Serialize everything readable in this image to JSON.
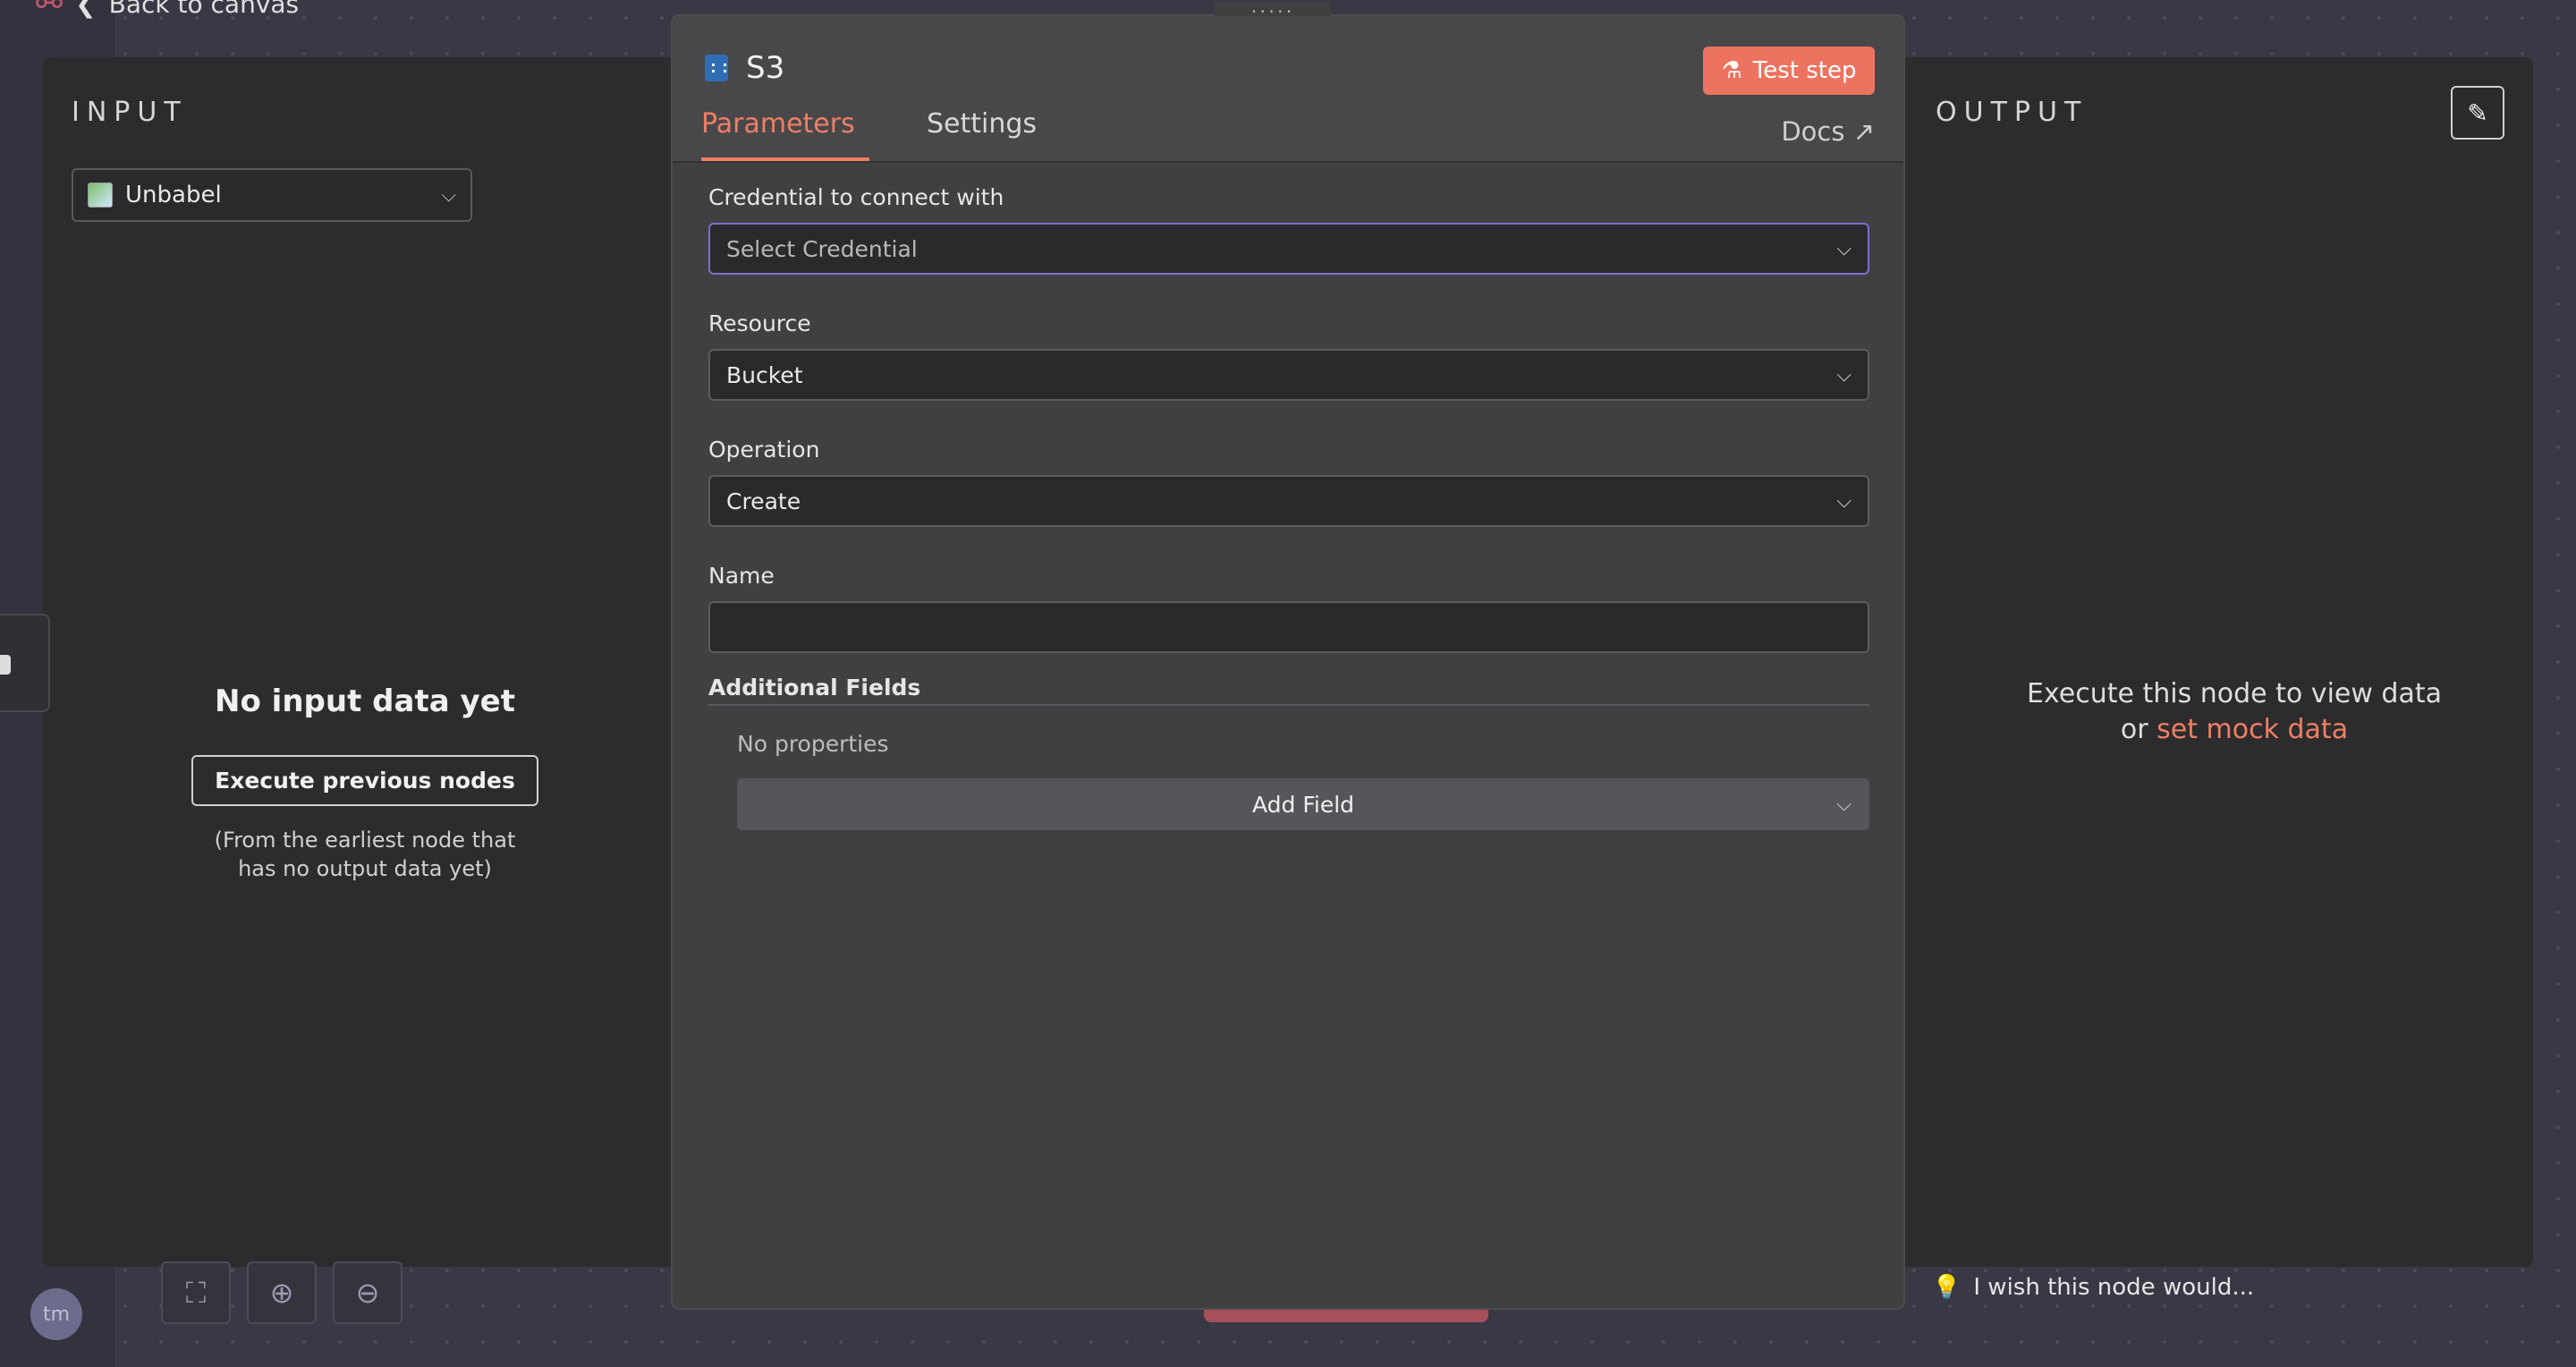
{
  "back": {
    "label": "Back to canvas"
  },
  "input_panel": {
    "title": "INPUT",
    "selected_node": "Unbabel",
    "empty_title": "No input data yet",
    "execute_button": "Execute previous nodes",
    "hint": "(From the earliest node that has no output data yet)"
  },
  "modal": {
    "drag_handle": ":::::",
    "node_name": "S3",
    "test_button": "Test step",
    "tabs": [
      "Parameters",
      "Settings"
    ],
    "docs_label": "Docs",
    "credential": {
      "label": "Credential to connect with",
      "placeholder": "Select Credential"
    },
    "resource": {
      "label": "Resource",
      "value": "Bucket"
    },
    "operation": {
      "label": "Operation",
      "value": "Create"
    },
    "name": {
      "label": "Name",
      "value": ""
    },
    "additional": {
      "label": "Additional Fields",
      "no_properties": "No properties",
      "add_button": "Add Field"
    }
  },
  "output_panel": {
    "title": "OUTPUT",
    "empty_line1": "Execute this node to view data",
    "empty_or": "or ",
    "mock_link": "set mock data"
  },
  "footer": {
    "avatar_initials": "tm",
    "wish_text": "I wish this node would..."
  },
  "colors": {
    "accent": "#ec7360",
    "credential_focus": "#7b6fd0"
  }
}
